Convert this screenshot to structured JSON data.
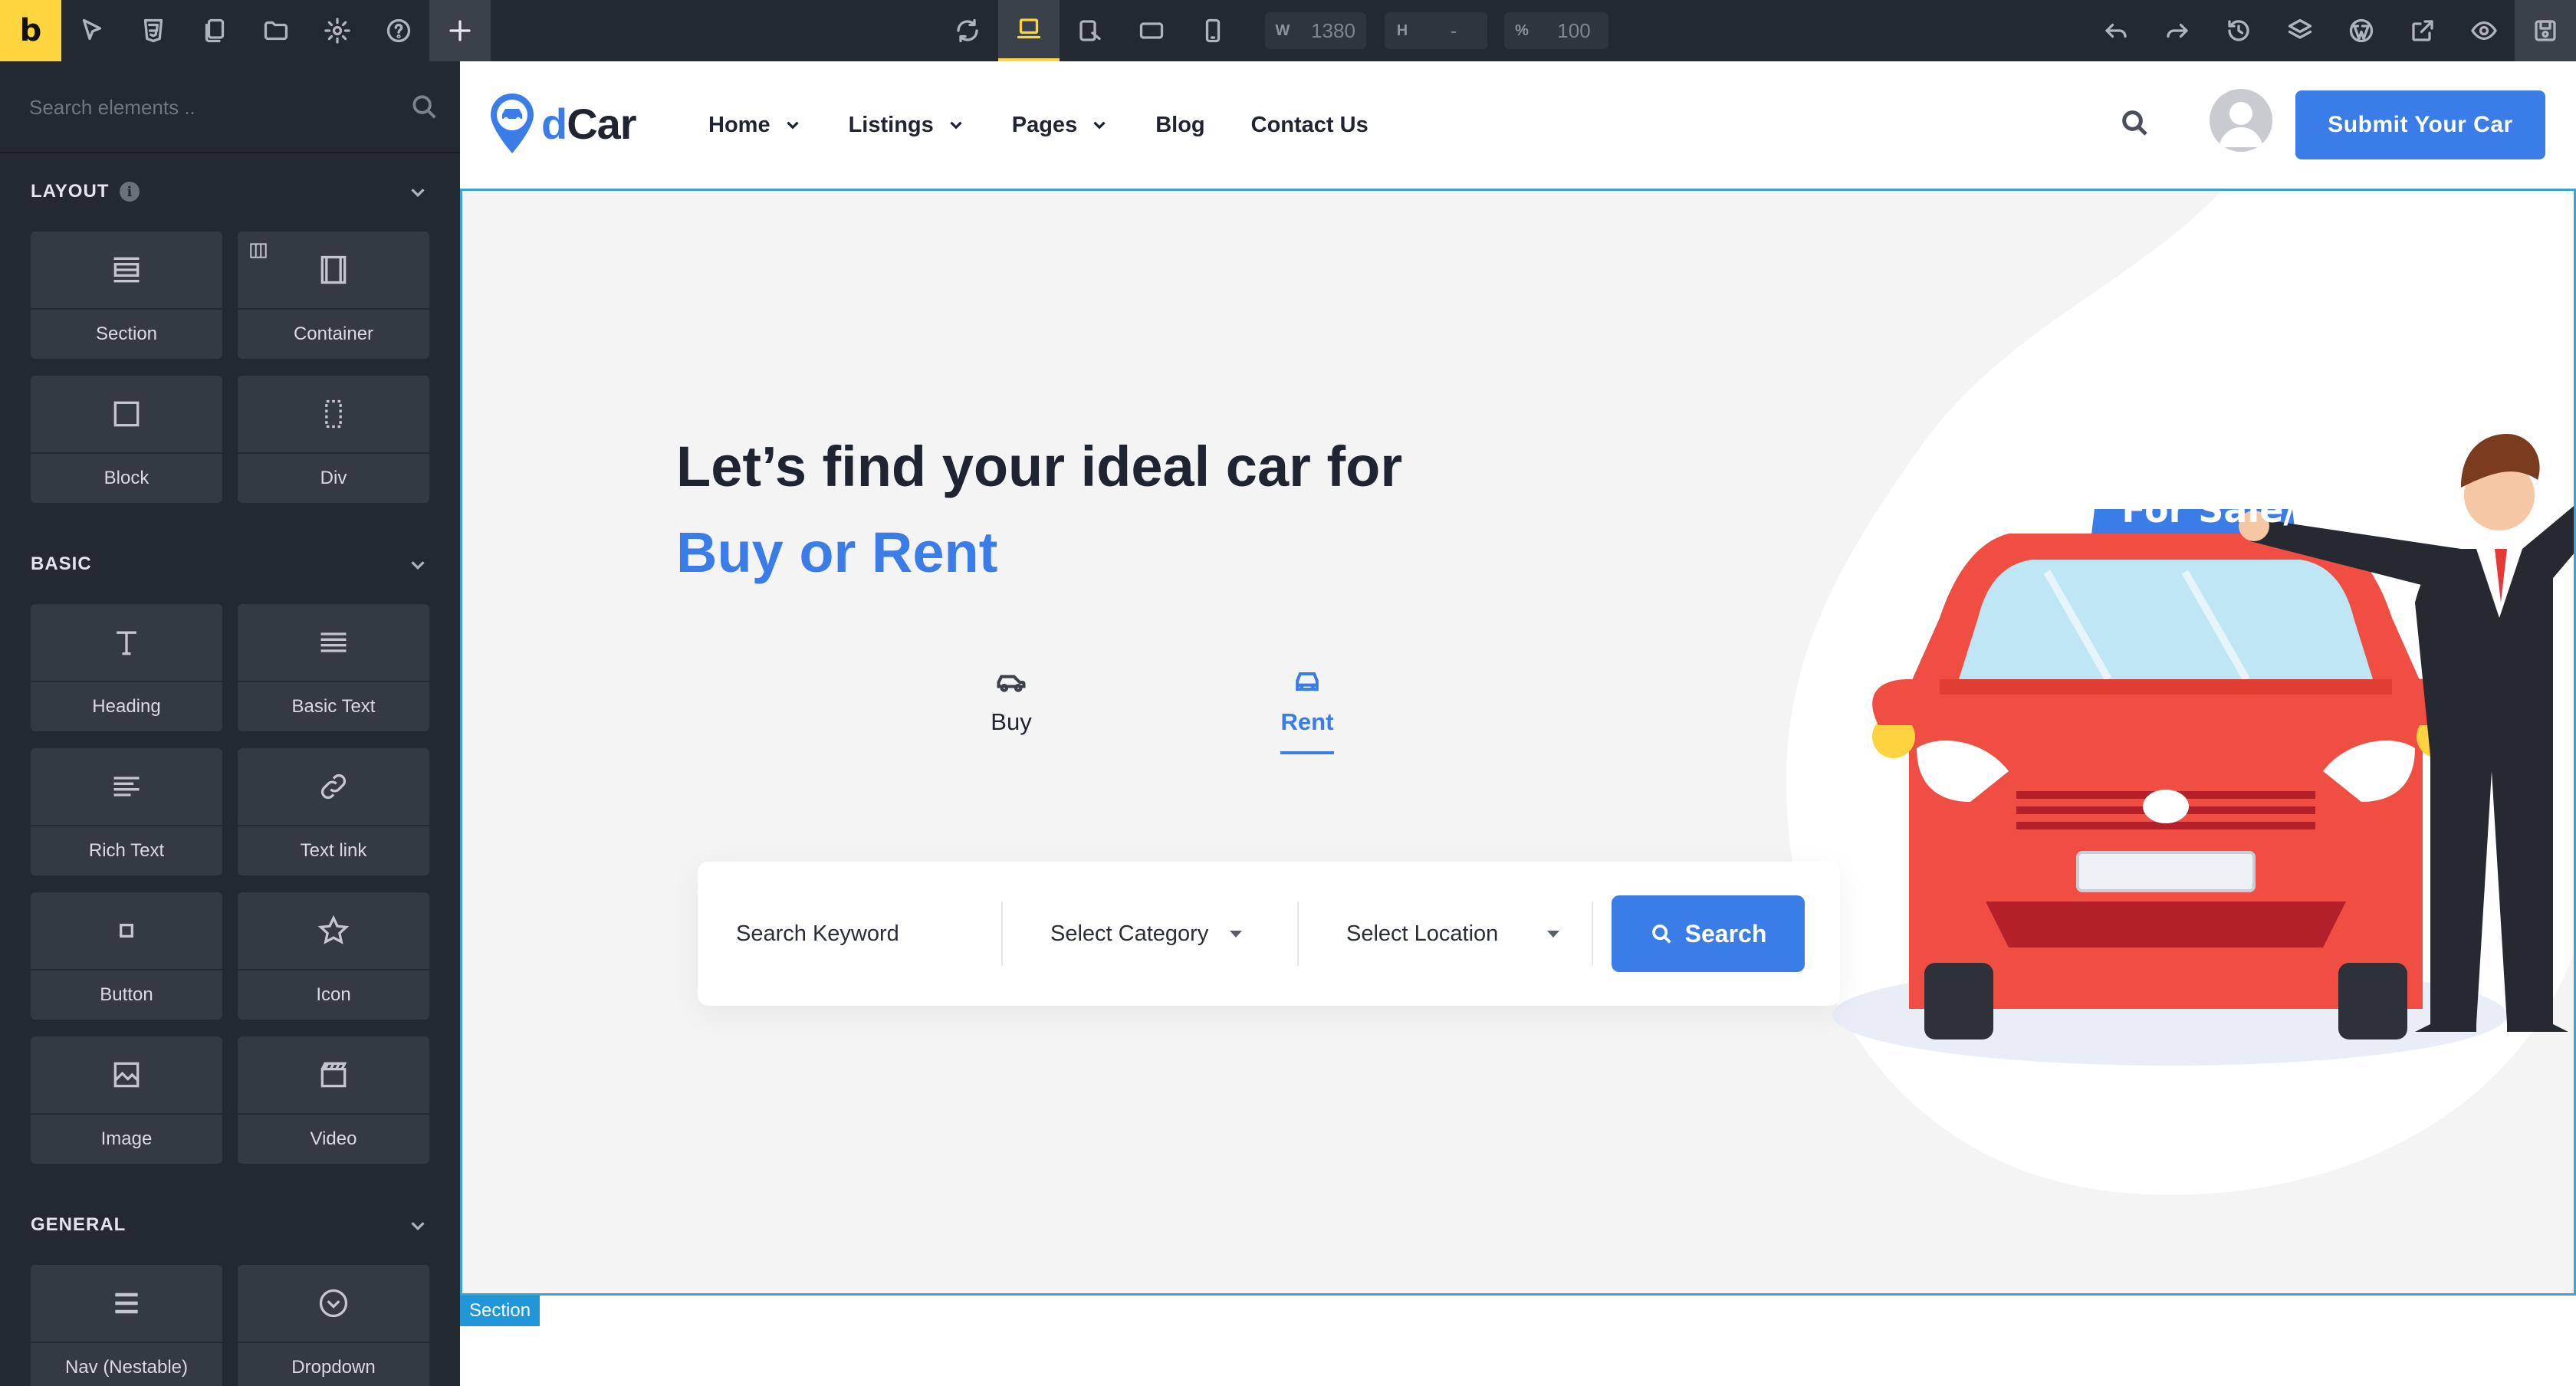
{
  "toolbar": {
    "logo": "b",
    "width_label": "W",
    "width_value": "1380",
    "height_label": "H",
    "height_value": "-",
    "zoom_label": "%",
    "zoom_value": "100"
  },
  "sidebar": {
    "search_placeholder": "Search elements ..",
    "categories": [
      {
        "label": "LAYOUT",
        "elements": [
          "Section",
          "Container",
          "Block",
          "Div"
        ]
      },
      {
        "label": "BASIC",
        "elements": [
          "Heading",
          "Basic Text",
          "Rich Text",
          "Text link",
          "Button",
          "Icon",
          "Image",
          "Video"
        ]
      },
      {
        "label": "GENERAL",
        "elements": [
          "Nav (Nestable)",
          "Dropdown"
        ]
      }
    ]
  },
  "site": {
    "brand_d": "d",
    "brand_rest": "Car",
    "nav": [
      "Home",
      "Listings",
      "Pages",
      "Blog",
      "Contact Us"
    ],
    "submit_label": "Submit Your Car",
    "hero_title": "Let’s find your ideal car for",
    "hero_subtitle": "Buy or Rent",
    "tabs": [
      "Buy",
      "Rent"
    ],
    "search_placeholder": "Search Keyword",
    "category_select": "Select Category",
    "location_select": "Select Location",
    "search_button": "Search",
    "sign_text": "For Sale/Rent",
    "section_tag": "Section"
  },
  "colors": {
    "accent": "#3a7de8",
    "builder_yellow": "#ffd53d",
    "builder_dark": "#232931",
    "car_red": "#f04e42"
  }
}
